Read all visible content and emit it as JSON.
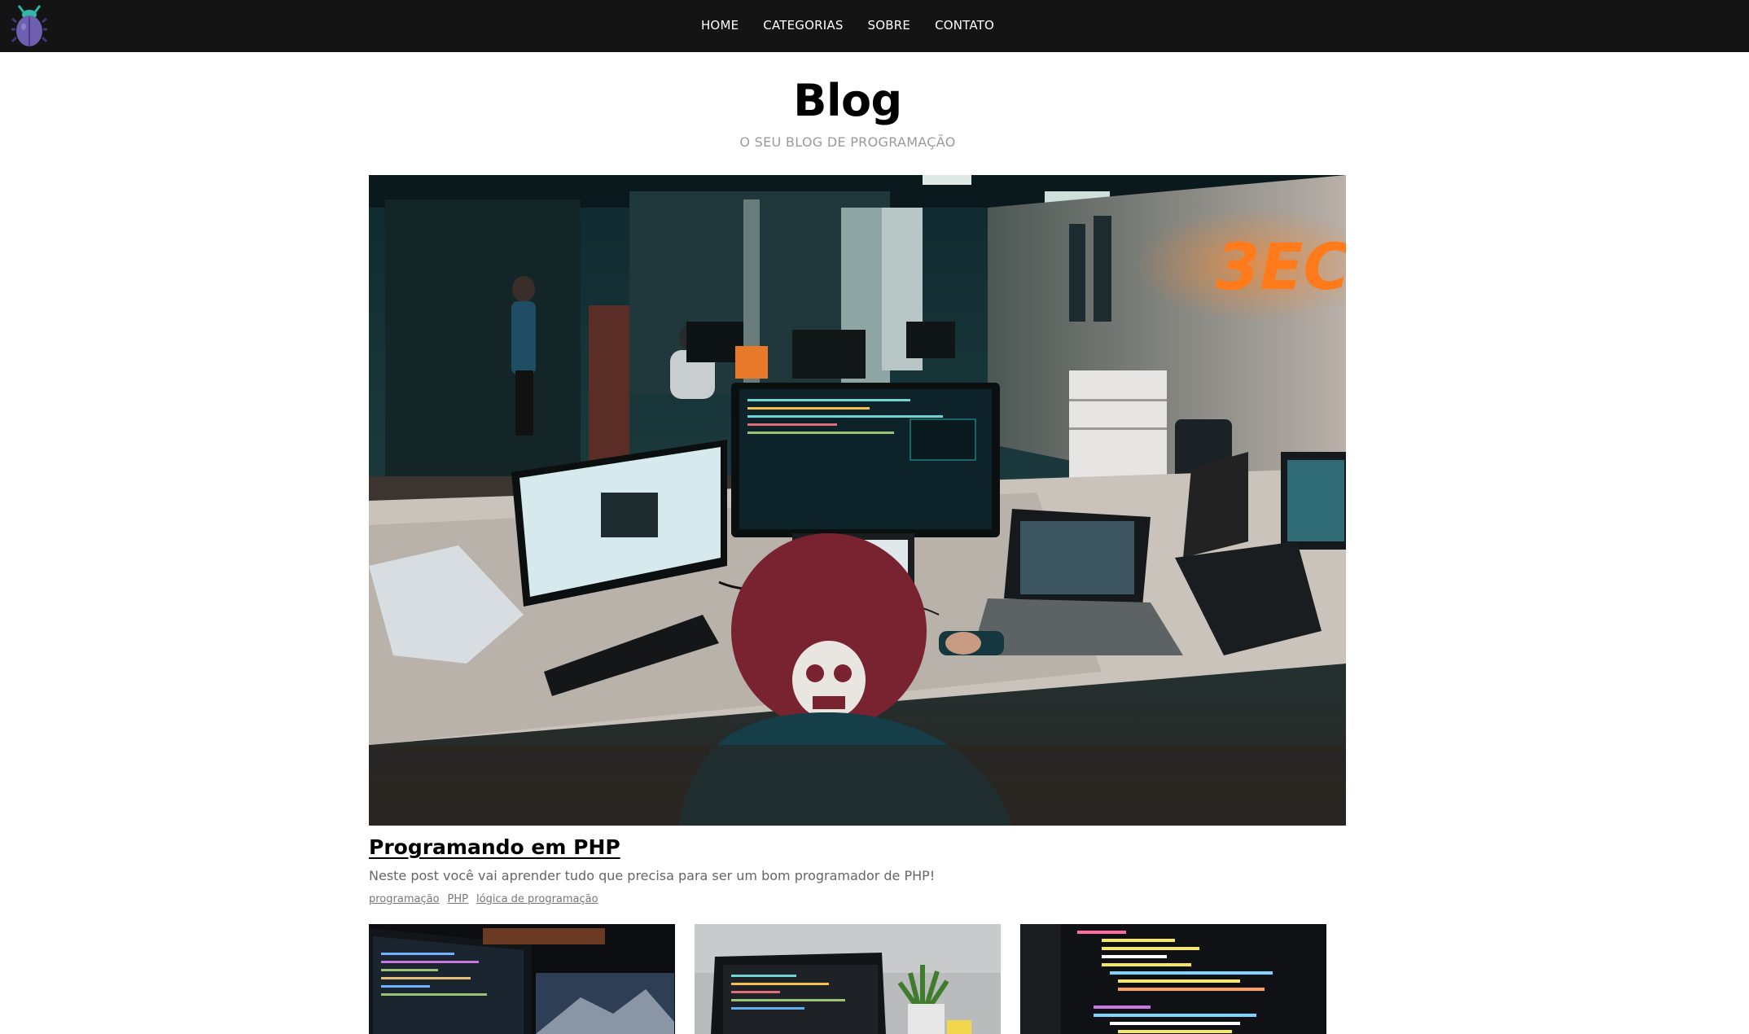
{
  "nav": {
    "items": [
      {
        "label": "HOME"
      },
      {
        "label": "CATEGORIAS"
      },
      {
        "label": "SOBRE"
      },
      {
        "label": "CONTATO"
      }
    ]
  },
  "header": {
    "title": "Blog",
    "subtitle": "O SEU BLOG DE PROGRAMAÇÃO"
  },
  "featured_post": {
    "title": "Programando em PHP",
    "description": "Neste post você vai aprender tudo que precisa para ser um bom programador de PHP!",
    "tags": [
      "programação",
      "PHP",
      "lógica de programação"
    ]
  },
  "icons": {
    "logo": "bug-icon"
  },
  "colors": {
    "topbar": "#141414",
    "logo_body": "#6f5fb0",
    "neon_sign": "#ff7a1a"
  }
}
